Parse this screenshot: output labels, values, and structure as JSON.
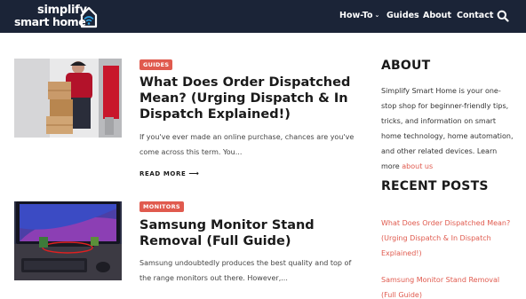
{
  "site": {
    "logo_top": "simplify",
    "logo_bottom": "smart home"
  },
  "nav": {
    "items": [
      {
        "label": "How-To",
        "has_dropdown": true
      },
      {
        "label": "Guides"
      },
      {
        "label": "About"
      },
      {
        "label": "Contact"
      }
    ],
    "search_icon": "search-icon"
  },
  "posts": [
    {
      "category": "GUIDES",
      "title": "What Does Order Dispatched Mean? (Urging Dispatch & In Dispatch Explained!)",
      "excerpt": "If you've ever made an online purchase, chances are you've come across this term. You...",
      "read_more": "READ MORE",
      "read_more_icon": "arrow-right-icon"
    },
    {
      "category": "MONITORS",
      "title": "Samsung Monitor Stand Removal (Full Guide)",
      "excerpt": "Samsung undoubtedly produces the best quality and top of the range monitors out there. However,..."
    }
  ],
  "sidebar": {
    "about_heading": "ABOUT",
    "about_text": "Simplify Smart Home is your one-stop shop for beginner-friendly tips, tricks, and information on smart home technology, home automation, and other related devices. Learn more ",
    "about_link": "about us",
    "recent_heading": "RECENT POSTS",
    "recent_posts": [
      "What Does Order Dispatched Mean? (Urging Dispatch & In Dispatch Explained!)",
      "Samsung Monitor Stand Removal (Full Guide)"
    ]
  },
  "colors": {
    "header_bg": "#1b2437",
    "accent": "#e05a4e"
  }
}
